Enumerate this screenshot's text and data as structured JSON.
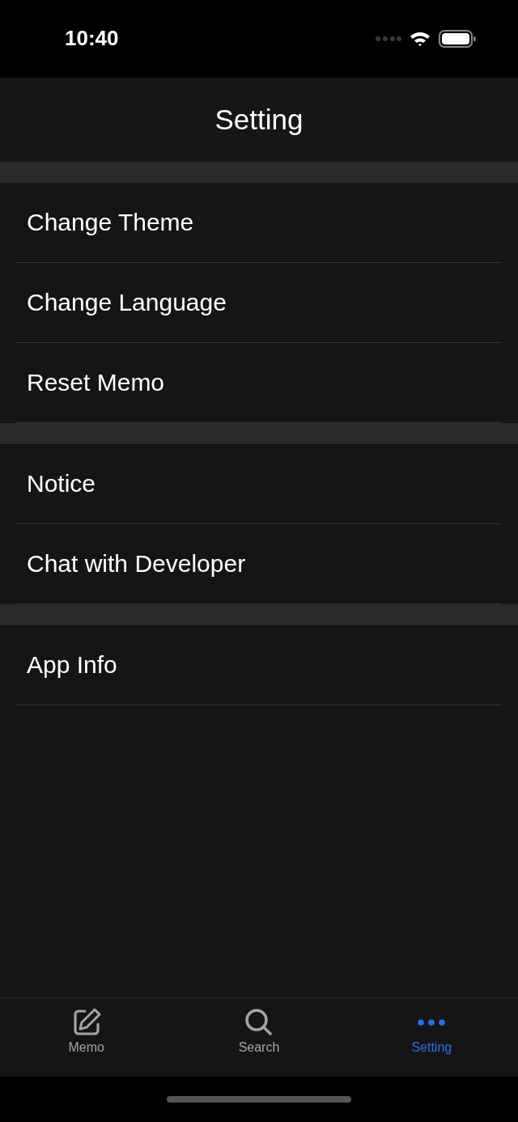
{
  "status_bar": {
    "time": "10:40"
  },
  "title": "Setting",
  "sections": [
    {
      "items": [
        "Change Theme",
        "Change Language",
        "Reset Memo"
      ]
    },
    {
      "items": [
        "Notice",
        "Chat with Developer"
      ]
    },
    {
      "items": [
        "App Info"
      ]
    }
  ],
  "tabs": [
    {
      "label": "Memo",
      "kind": "memo",
      "selected": false
    },
    {
      "label": "Search",
      "kind": "search",
      "selected": false
    },
    {
      "label": "Setting",
      "kind": "more",
      "selected": true
    }
  ]
}
